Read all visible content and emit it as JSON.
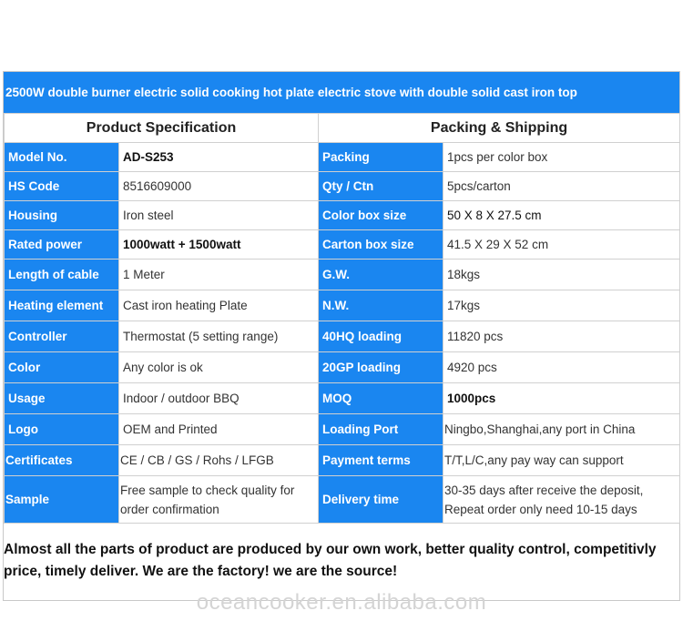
{
  "title": "2500W double burner electric solid cooking hot plate electric stove with double solid cast iron top",
  "headers": {
    "left": "Product Specification",
    "right": "Packing & Shipping"
  },
  "rows": [
    {
      "lk": "Model No.",
      "lv": "AD-S253",
      "rk": "Packing",
      "rv": "1pcs per color box"
    },
    {
      "lk": "HS Code",
      "lv": "8516609000",
      "rk": "Qty / Ctn",
      "rv": "5pcs/carton"
    },
    {
      "lk": "Housing",
      "lv": "Iron steel",
      "rk": "Color box size",
      "rv": "50 X 8 X 27.5 cm"
    },
    {
      "lk": "Rated power",
      "lv": "1000watt + 1500watt",
      "rk": "Carton box size",
      "rv": "41.5 X 29 X 52 cm"
    },
    {
      "lk": "Length of cable",
      "lv": "1 Meter",
      "rk": "G.W.",
      "rv": "18kgs"
    },
    {
      "lk": "Heating element",
      "lv": "Cast iron heating Plate",
      "rk": "N.W.",
      "rv": "17kgs"
    },
    {
      "lk": "Controller",
      "lv": "Thermostat (5 setting range)",
      "rk": "40HQ loading",
      "rv": "11820 pcs"
    },
    {
      "lk": "Color",
      "lv": "Any color is ok",
      "rk": "20GP loading",
      "rv": "4920 pcs"
    },
    {
      "lk": "Usage",
      "lv": "Indoor / outdoor BBQ",
      "rk": "MOQ",
      "rv": "1000pcs"
    },
    {
      "lk": "Logo",
      "lv": "OEM and Printed",
      "rk": "Loading Port",
      "rv": "Ningbo,Shanghai,any port in China"
    },
    {
      "lk": "Certificates",
      "lv": "CE / CB / GS / Rohs / LFGB",
      "rk": "Payment terms",
      "rv": "T/T,L/C,any pay way can support"
    },
    {
      "lk": "Sample",
      "lv": "Free sample  to check quality for order confirmation",
      "rk": "Delivery time",
      "rv": "30-35 days after receive the deposit, Repeat order only need 10-15 days"
    }
  ],
  "note": "Almost all the parts of product are produced by our own work, better quality control, competitivly price, timely deliver. We are the factory! we are the source!",
  "watermark": "oceancooker.en.alibaba.com",
  "colors": {
    "accent": "#1a86f0"
  }
}
